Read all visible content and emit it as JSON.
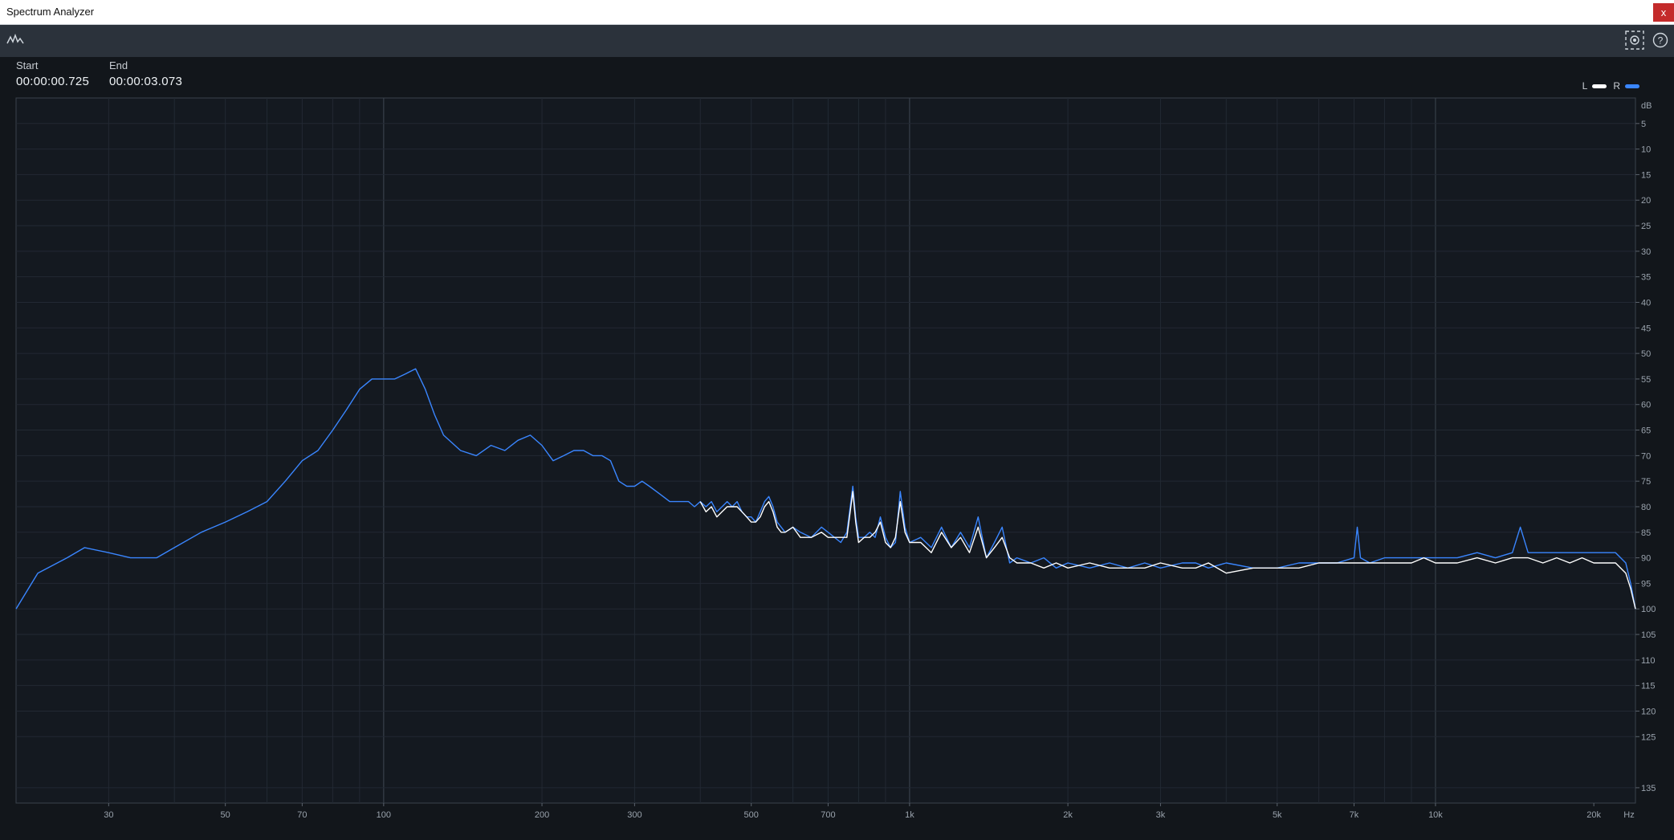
{
  "window": {
    "title": "Spectrum Analyzer",
    "close_label": "x"
  },
  "toolbar": {
    "left_icon": "waveform-icon",
    "right_icons": [
      "snapshot-icon",
      "help-icon"
    ]
  },
  "selection": {
    "start_label": "Start",
    "start_value": "00:00:00.725",
    "end_label": "End",
    "end_value": "00:00:03.073"
  },
  "legend": {
    "left_label": "L",
    "right_label": "R",
    "left_color": "#ffffff",
    "right_color": "#3a86ff"
  },
  "chart_data": {
    "type": "line",
    "xscale": "log",
    "xlim": [
      20,
      24000
    ],
    "ylim": [
      0,
      138
    ],
    "y_inverted": true,
    "grid": true,
    "ylabel": "dB",
    "xlabel": "Hz",
    "x_ticks": [
      {
        "v": 30,
        "label": "30"
      },
      {
        "v": 50,
        "label": "50"
      },
      {
        "v": 70,
        "label": "70"
      },
      {
        "v": 100,
        "label": "100"
      },
      {
        "v": 200,
        "label": "200"
      },
      {
        "v": 300,
        "label": "300"
      },
      {
        "v": 500,
        "label": "500"
      },
      {
        "v": 700,
        "label": "700"
      },
      {
        "v": 1000,
        "label": "1k"
      },
      {
        "v": 2000,
        "label": "2k"
      },
      {
        "v": 3000,
        "label": "3k"
      },
      {
        "v": 5000,
        "label": "5k"
      },
      {
        "v": 7000,
        "label": "7k"
      },
      {
        "v": 10000,
        "label": "10k"
      },
      {
        "v": 20000,
        "label": "20k"
      }
    ],
    "y_ticks": [
      5,
      10,
      15,
      20,
      25,
      30,
      35,
      40,
      45,
      50,
      55,
      60,
      65,
      70,
      75,
      80,
      85,
      90,
      95,
      100,
      105,
      110,
      115,
      120,
      125,
      135
    ],
    "series": [
      {
        "name": "R",
        "color": "#3a86ff",
        "points": [
          [
            20,
            100
          ],
          [
            22,
            93
          ],
          [
            25,
            90
          ],
          [
            27,
            88
          ],
          [
            30,
            89
          ],
          [
            33,
            90
          ],
          [
            37,
            90
          ],
          [
            40,
            88
          ],
          [
            45,
            85
          ],
          [
            50,
            83
          ],
          [
            55,
            81
          ],
          [
            60,
            79
          ],
          [
            65,
            75
          ],
          [
            70,
            71
          ],
          [
            75,
            69
          ],
          [
            80,
            65
          ],
          [
            85,
            61
          ],
          [
            90,
            57
          ],
          [
            95,
            55
          ],
          [
            100,
            55
          ],
          [
            105,
            55
          ],
          [
            110,
            54
          ],
          [
            115,
            53
          ],
          [
            120,
            57
          ],
          [
            125,
            62
          ],
          [
            130,
            66
          ],
          [
            140,
            69
          ],
          [
            150,
            70
          ],
          [
            160,
            68
          ],
          [
            170,
            69
          ],
          [
            180,
            67
          ],
          [
            190,
            66
          ],
          [
            200,
            68
          ],
          [
            210,
            71
          ],
          [
            220,
            70
          ],
          [
            230,
            69
          ],
          [
            240,
            69
          ],
          [
            250,
            70
          ],
          [
            260,
            70
          ],
          [
            270,
            71
          ],
          [
            280,
            75
          ],
          [
            290,
            76
          ],
          [
            300,
            76
          ],
          [
            310,
            75
          ],
          [
            320,
            76
          ],
          [
            330,
            77
          ],
          [
            340,
            78
          ],
          [
            350,
            79
          ],
          [
            360,
            79
          ],
          [
            370,
            79
          ],
          [
            380,
            79
          ],
          [
            390,
            80
          ],
          [
            400,
            79
          ],
          [
            410,
            80
          ],
          [
            420,
            79
          ],
          [
            430,
            81
          ],
          [
            440,
            80
          ],
          [
            450,
            79
          ],
          [
            460,
            80
          ],
          [
            470,
            79
          ],
          [
            480,
            81
          ],
          [
            490,
            82
          ],
          [
            500,
            82
          ],
          [
            510,
            83
          ],
          [
            520,
            81
          ],
          [
            530,
            79
          ],
          [
            540,
            78
          ],
          [
            550,
            80
          ],
          [
            560,
            83
          ],
          [
            570,
            84
          ],
          [
            580,
            85
          ],
          [
            600,
            84
          ],
          [
            620,
            85
          ],
          [
            650,
            86
          ],
          [
            680,
            84
          ],
          [
            700,
            85
          ],
          [
            720,
            86
          ],
          [
            740,
            87
          ],
          [
            760,
            85
          ],
          [
            780,
            76
          ],
          [
            790,
            82
          ],
          [
            800,
            86
          ],
          [
            820,
            86
          ],
          [
            840,
            85
          ],
          [
            860,
            86
          ],
          [
            880,
            82
          ],
          [
            900,
            86
          ],
          [
            920,
            88
          ],
          [
            940,
            87
          ],
          [
            960,
            77
          ],
          [
            980,
            84
          ],
          [
            1000,
            87
          ],
          [
            1050,
            86
          ],
          [
            1100,
            88
          ],
          [
            1150,
            84
          ],
          [
            1200,
            88
          ],
          [
            1250,
            85
          ],
          [
            1300,
            88
          ],
          [
            1350,
            82
          ],
          [
            1400,
            90
          ],
          [
            1450,
            87
          ],
          [
            1500,
            84
          ],
          [
            1550,
            91
          ],
          [
            1600,
            90
          ],
          [
            1700,
            91
          ],
          [
            1800,
            90
          ],
          [
            1900,
            92
          ],
          [
            2000,
            91
          ],
          [
            2200,
            92
          ],
          [
            2400,
            91
          ],
          [
            2600,
            92
          ],
          [
            2800,
            91
          ],
          [
            3000,
            92
          ],
          [
            3300,
            91
          ],
          [
            3500,
            91
          ],
          [
            3700,
            92
          ],
          [
            4000,
            91
          ],
          [
            4500,
            92
          ],
          [
            5000,
            92
          ],
          [
            5500,
            91
          ],
          [
            6000,
            91
          ],
          [
            6500,
            91
          ],
          [
            7000,
            90
          ],
          [
            7100,
            84
          ],
          [
            7200,
            90
          ],
          [
            7500,
            91
          ],
          [
            8000,
            90
          ],
          [
            8500,
            90
          ],
          [
            9000,
            90
          ],
          [
            9500,
            90
          ],
          [
            10000,
            90
          ],
          [
            11000,
            90
          ],
          [
            12000,
            89
          ],
          [
            13000,
            90
          ],
          [
            14000,
            89
          ],
          [
            14500,
            84
          ],
          [
            15000,
            89
          ],
          [
            16000,
            89
          ],
          [
            17000,
            89
          ],
          [
            18000,
            89
          ],
          [
            19000,
            89
          ],
          [
            20000,
            89
          ],
          [
            21000,
            89
          ],
          [
            22000,
            89
          ],
          [
            23000,
            91
          ],
          [
            23500,
            95
          ],
          [
            24000,
            100
          ]
        ]
      },
      {
        "name": "L",
        "color": "#ffffff",
        "points": [
          [
            400,
            79
          ],
          [
            410,
            81
          ],
          [
            420,
            80
          ],
          [
            430,
            82
          ],
          [
            440,
            81
          ],
          [
            450,
            80
          ],
          [
            460,
            80
          ],
          [
            470,
            80
          ],
          [
            480,
            81
          ],
          [
            490,
            82
          ],
          [
            500,
            83
          ],
          [
            510,
            83
          ],
          [
            520,
            82
          ],
          [
            530,
            80
          ],
          [
            540,
            79
          ],
          [
            550,
            81
          ],
          [
            560,
            84
          ],
          [
            570,
            85
          ],
          [
            580,
            85
          ],
          [
            600,
            84
          ],
          [
            620,
            86
          ],
          [
            650,
            86
          ],
          [
            680,
            85
          ],
          [
            700,
            86
          ],
          [
            720,
            86
          ],
          [
            740,
            86
          ],
          [
            760,
            86
          ],
          [
            780,
            77
          ],
          [
            790,
            83
          ],
          [
            800,
            87
          ],
          [
            820,
            86
          ],
          [
            840,
            86
          ],
          [
            860,
            85
          ],
          [
            880,
            83
          ],
          [
            900,
            87
          ],
          [
            920,
            88
          ],
          [
            940,
            86
          ],
          [
            960,
            79
          ],
          [
            980,
            85
          ],
          [
            1000,
            87
          ],
          [
            1050,
            87
          ],
          [
            1100,
            89
          ],
          [
            1150,
            85
          ],
          [
            1200,
            88
          ],
          [
            1250,
            86
          ],
          [
            1300,
            89
          ],
          [
            1350,
            84
          ],
          [
            1400,
            90
          ],
          [
            1450,
            88
          ],
          [
            1500,
            86
          ],
          [
            1550,
            90
          ],
          [
            1600,
            91
          ],
          [
            1700,
            91
          ],
          [
            1800,
            92
          ],
          [
            1900,
            91
          ],
          [
            2000,
            92
          ],
          [
            2200,
            91
          ],
          [
            2400,
            92
          ],
          [
            2600,
            92
          ],
          [
            2800,
            92
          ],
          [
            3000,
            91
          ],
          [
            3300,
            92
          ],
          [
            3500,
            92
          ],
          [
            3700,
            91
          ],
          [
            4000,
            93
          ],
          [
            4500,
            92
          ],
          [
            5000,
            92
          ],
          [
            5500,
            92
          ],
          [
            6000,
            91
          ],
          [
            6500,
            91
          ],
          [
            7000,
            91
          ],
          [
            7500,
            91
          ],
          [
            8000,
            91
          ],
          [
            8500,
            91
          ],
          [
            9000,
            91
          ],
          [
            9500,
            90
          ],
          [
            10000,
            91
          ],
          [
            11000,
            91
          ],
          [
            12000,
            90
          ],
          [
            13000,
            91
          ],
          [
            14000,
            90
          ],
          [
            15000,
            90
          ],
          [
            16000,
            91
          ],
          [
            17000,
            90
          ],
          [
            18000,
            91
          ],
          [
            19000,
            90
          ],
          [
            20000,
            91
          ],
          [
            21000,
            91
          ],
          [
            22000,
            91
          ],
          [
            23000,
            93
          ],
          [
            23500,
            96
          ],
          [
            24000,
            100
          ]
        ]
      }
    ]
  }
}
